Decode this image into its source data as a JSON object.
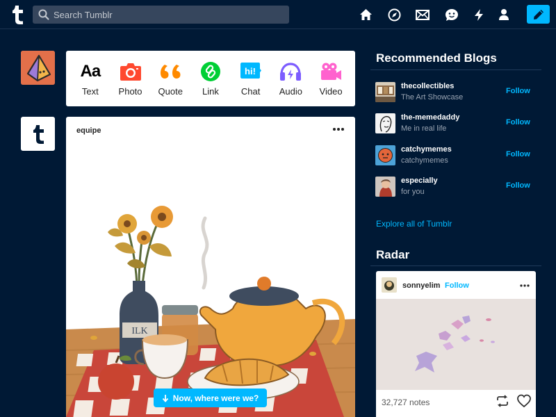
{
  "header": {
    "search_placeholder": "Search Tumblr",
    "nav_icons": [
      "home-icon",
      "explore-icon",
      "inbox-icon",
      "messages-icon",
      "activity-icon",
      "account-icon"
    ],
    "compose_icon": "pencil-icon"
  },
  "post_types": [
    {
      "label": "Text",
      "icon": "text-icon",
      "glyph": "Aa",
      "color": "#000000"
    },
    {
      "label": "Photo",
      "icon": "camera-icon",
      "color": "#ff492f"
    },
    {
      "label": "Quote",
      "icon": "quote-icon",
      "glyph": "66",
      "color": "#ff8a00"
    },
    {
      "label": "Link",
      "icon": "link-icon",
      "color": "#00cf35"
    },
    {
      "label": "Chat",
      "icon": "chat-icon",
      "glyph": "hi!",
      "color": "#00b8ff"
    },
    {
      "label": "Audio",
      "icon": "headphones-icon",
      "color": "#7c5cff"
    },
    {
      "label": "Video",
      "icon": "video-camera-icon",
      "color": "#ff62ce"
    }
  ],
  "post": {
    "author": "equipe",
    "image": "illustration-teapot-flowers-croissant"
  },
  "scroll_pill": {
    "label": "Now, where were we?",
    "icon": "arrow-down-icon"
  },
  "recommended": {
    "title": "Recommended Blogs",
    "blogs": [
      {
        "name": "thecollectibles",
        "subtitle": "The Art Showcase",
        "follow": "Follow"
      },
      {
        "name": "the-memedaddy",
        "subtitle": "Me in real life",
        "follow": "Follow"
      },
      {
        "name": "catchymemes",
        "subtitle": "catchymemes",
        "follow": "Follow"
      },
      {
        "name": "especially",
        "subtitle": "for you",
        "follow": "Follow"
      }
    ],
    "explore_link": "Explore all of Tumblr"
  },
  "radar": {
    "title": "Radar",
    "user": "sonnyelim",
    "follow": "Follow",
    "notes": "32,727 notes"
  },
  "colors": {
    "background": "#001935",
    "accent": "#00b8ff",
    "search_bg": "#36465d"
  }
}
